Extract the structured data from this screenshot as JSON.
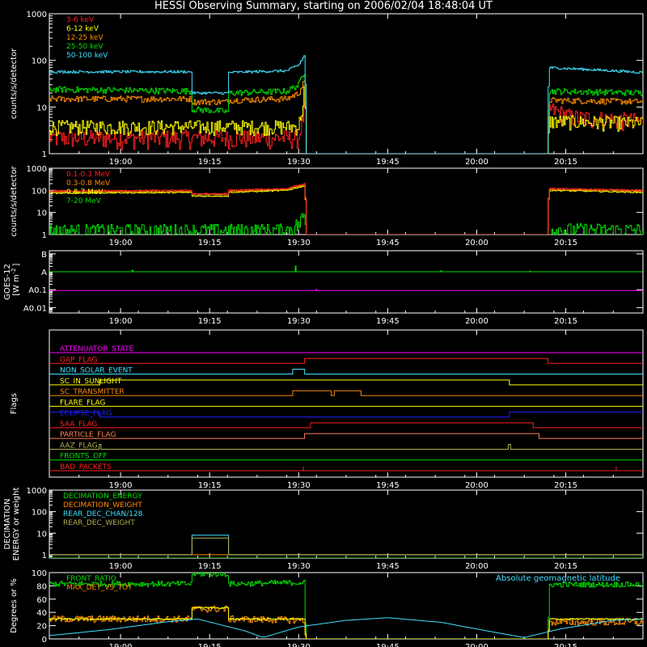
{
  "title": "HESSI Observing Summary, starting on 2006/02/04 18:48:04 UT",
  "time_axis": {
    "ticks": [
      "19:00",
      "19:15",
      "19:30",
      "19:45",
      "20:00",
      "20:15"
    ],
    "tick_minutes": [
      12,
      27,
      42,
      57,
      72,
      87
    ],
    "range_minutes": [
      0,
      100
    ]
  },
  "colors": {
    "red": "#ff2020",
    "orange": "#ff8c00",
    "yellow": "#ffff00",
    "green": "#00e000",
    "cyan": "#40e0ff",
    "magenta": "#ff00ff",
    "blue": "#2020ff",
    "olive": "#b0b050",
    "brown": "#ff7f50",
    "white": "#ffffff"
  },
  "chart_data": [
    {
      "type": "line",
      "name": "count-rates",
      "ylabel": "counts/s/detector",
      "log": true,
      "ylim": [
        1,
        1000
      ],
      "yticks": [
        "1",
        "10",
        "100",
        "1000"
      ],
      "legend": [
        "3-6 keV",
        "6-12 keV",
        "12-25 keV",
        "25-50 keV",
        "50-100 keV"
      ],
      "series": [
        {
          "name": "3-6 keV",
          "color": "red",
          "noise": 0.15,
          "points": [
            [
              0,
              2.2
            ],
            [
              42,
              2.2
            ],
            [
              42.7,
              6
            ],
            [
              43,
              30
            ],
            [
              43.1,
              1
            ],
            [
              84,
              1
            ],
            [
              84.1,
              9
            ],
            [
              88,
              6
            ],
            [
              100,
              5
            ]
          ]
        },
        {
          "name": "6-12 keV",
          "color": "yellow",
          "noise": 0.12,
          "points": [
            [
              0,
              3.8
            ],
            [
              42,
              3.8
            ],
            [
              42.7,
              10
            ],
            [
              43,
              30
            ],
            [
              43.1,
              1
            ],
            [
              84,
              1
            ],
            [
              84.1,
              5
            ],
            [
              100,
              4.5
            ]
          ]
        },
        {
          "name": "12-25 keV",
          "color": "orange",
          "noise": 0.05,
          "points": [
            [
              0,
              15
            ],
            [
              24,
              15
            ],
            [
              24,
              13
            ],
            [
              30,
              13
            ],
            [
              30,
              14
            ],
            [
              40,
              15
            ],
            [
              42,
              20
            ],
            [
              43,
              35
            ],
            [
              43.1,
              1
            ],
            [
              84,
              1
            ],
            [
              84.1,
              14
            ],
            [
              100,
              13
            ]
          ]
        },
        {
          "name": "25-50 keV",
          "color": "green",
          "noise": 0.05,
          "points": [
            [
              0,
              24
            ],
            [
              24,
              22
            ],
            [
              24,
              9
            ],
            [
              30,
              8
            ],
            [
              30,
              20
            ],
            [
              40,
              22
            ],
            [
              42,
              30
            ],
            [
              43,
              60
            ],
            [
              43.1,
              1
            ],
            [
              84,
              1
            ],
            [
              84.1,
              22
            ],
            [
              100,
              20
            ]
          ]
        },
        {
          "name": "50-100 keV",
          "color": "cyan",
          "noise": 0.02,
          "points": [
            [
              0,
              57
            ],
            [
              24,
              57
            ],
            [
              24,
              20
            ],
            [
              30,
              20
            ],
            [
              30,
              55
            ],
            [
              40,
              60
            ],
            [
              42,
              80
            ],
            [
              43,
              130
            ],
            [
              43.1,
              1
            ],
            [
              84,
              1
            ],
            [
              84.1,
              70
            ],
            [
              100,
              55
            ]
          ]
        }
      ]
    },
    {
      "type": "line",
      "name": "high-energy-rates",
      "ylabel": "counts/s/detector",
      "log": true,
      "ylim": [
        1,
        1000
      ],
      "yticks": [
        "1",
        "10",
        "100",
        "1000"
      ],
      "legend": [
        "0.1-0.3 MeV",
        "0.3-0.8 MeV",
        "0.8-7 MeV",
        "7-20 MeV"
      ],
      "series": [
        {
          "name": "7-20 MeV",
          "color": "green",
          "noise": 0.3,
          "points": [
            [
              0,
              1.5
            ],
            [
              40,
              1.6
            ],
            [
              42,
              3
            ],
            [
              43,
              8
            ],
            [
              43.1,
              1
            ],
            [
              84,
              1
            ],
            [
              84.1,
              1.7
            ],
            [
              100,
              1.6
            ]
          ]
        },
        {
          "name": "0.8-7 MeV",
          "color": "yellow",
          "noise": 0.02,
          "points": [
            [
              0,
              75
            ],
            [
              24,
              80
            ],
            [
              24,
              55
            ],
            [
              30,
              55
            ],
            [
              30,
              80
            ],
            [
              40,
              100
            ],
            [
              43,
              160
            ],
            [
              43.1,
              1
            ],
            [
              84,
              1
            ],
            [
              84.1,
              100
            ],
            [
              100,
              80
            ]
          ]
        },
        {
          "name": "0.3-0.8 MeV",
          "color": "orange",
          "noise": 0.02,
          "points": [
            [
              0,
              85
            ],
            [
              24,
              90
            ],
            [
              24,
              65
            ],
            [
              30,
              65
            ],
            [
              30,
              90
            ],
            [
              40,
              110
            ],
            [
              43,
              180
            ],
            [
              43.1,
              1
            ],
            [
              84,
              1
            ],
            [
              84.1,
              110
            ],
            [
              100,
              90
            ]
          ]
        },
        {
          "name": "0.1-0.3 MeV",
          "color": "red",
          "noise": 0.02,
          "points": [
            [
              0,
              95
            ],
            [
              24,
              100
            ],
            [
              24,
              70
            ],
            [
              30,
              70
            ],
            [
              30,
              100
            ],
            [
              40,
              120
            ],
            [
              43,
              200
            ],
            [
              43.1,
              1
            ],
            [
              84,
              1
            ],
            [
              84.1,
              120
            ],
            [
              100,
              100
            ]
          ]
        }
      ]
    },
    {
      "type": "line",
      "name": "goes",
      "ylabel": "GOES-12\n[W m⁻²]",
      "ylabel_lines": [
        "GOES-12",
        "[W m",
        "-2",
        "]"
      ],
      "log": true,
      "ylim": [
        0.005,
        15
      ],
      "yticks": [
        "A0.01",
        "A0.1",
        "A",
        "B"
      ],
      "ytick_values": [
        0.01,
        0.1,
        1,
        10
      ],
      "series": [
        {
          "name": "goes-long",
          "color": "green",
          "noise": 0,
          "points": [
            [
              0,
              1
            ],
            [
              100,
              1
            ]
          ],
          "spikes": [
            [
              14,
              1.3
            ],
            [
              41.5,
              2.2
            ],
            [
              66,
              1.2
            ],
            [
              81,
              1.15
            ]
          ]
        },
        {
          "name": "goes-short",
          "color": "magenta",
          "noise": 0,
          "points": [
            [
              0,
              0.09
            ],
            [
              100,
              0.09
            ]
          ],
          "spikes": [
            [
              45,
              0.11
            ]
          ]
        }
      ]
    },
    {
      "type": "line",
      "name": "flags",
      "ylabel": "Flags",
      "flags": [
        {
          "label": "ATTENUATOR_STATE",
          "color": "magenta",
          "segments": []
        },
        {
          "label": "GAP_FLAG",
          "color": "red",
          "segments": [
            [
              43,
              84
            ]
          ]
        },
        {
          "label": "NON_SOLAR_EVENT",
          "color": "cyan",
          "segments": [
            [
              41,
              43
            ]
          ]
        },
        {
          "label": "SC_IN_SUNLIGHT",
          "color": "yellow",
          "segments": [
            [
              0,
              0
            ]
          ],
          "invert_segments": [
            [
              8.5,
              77.5
            ]
          ]
        },
        {
          "label": "SC_TRANSMITTER",
          "color": "orange",
          "segments": [
            [
              41,
              47.5
            ],
            [
              48,
              52.5
            ]
          ]
        },
        {
          "label": "FLARE_FLAG",
          "color": "yellow",
          "segments": []
        },
        {
          "label": "ECLIPSE_FLAG",
          "color": "blue",
          "segments": [
            [
              0,
              8.5
            ],
            [
              77.5,
              100
            ]
          ]
        },
        {
          "label": "SAA_FLAG",
          "color": "red",
          "segments": [
            [
              44,
              81.5
            ]
          ]
        },
        {
          "label": "PARTICLE_FLAG",
          "color": "brown",
          "segments": [
            [
              43,
              82.5
            ]
          ]
        },
        {
          "label": "AAZ_FLAG",
          "color": "olive",
          "segments": [
            [
              8.4,
              8.7
            ],
            [
              77.3,
              77.7
            ]
          ]
        },
        {
          "label": "FRONTS_OFF",
          "color": "green",
          "segments": []
        },
        {
          "label": "BAD_PACKETS",
          "color": "red",
          "segments": [],
          "ticks": [
            42.8,
            95.5
          ]
        }
      ]
    },
    {
      "type": "line",
      "name": "decimation",
      "ylabel": "DECIMATION\nENERGY or weight",
      "ylabel_lines": [
        "DECIMATION",
        "ENERGY or weight"
      ],
      "log": true,
      "ylim": [
        0.7,
        1000
      ],
      "yticks": [
        "1",
        "10",
        "100",
        "1000"
      ],
      "legend": [
        "DECIMATION_ENERGY",
        "DECIMATION_WEIGHT",
        "REAR_DEC_CHAN/128",
        "REAR_DEC_WEIGHT"
      ],
      "series": [
        {
          "name": "DECIMATION_ENERGY",
          "color": "green",
          "noise": 0,
          "points": [
            [
              0,
              0.7
            ],
            [
              100,
              0.7
            ]
          ]
        },
        {
          "name": "DECIMATION_WEIGHT",
          "color": "orange",
          "noise": 0,
          "points": [
            [
              0,
              1
            ],
            [
              100,
              1
            ]
          ]
        },
        {
          "name": "REAR_DEC_CHAN/128",
          "color": "cyan",
          "noise": 0,
          "points": [
            [
              0,
              1
            ],
            [
              24,
              1
            ],
            [
              24,
              8
            ],
            [
              30,
              8
            ],
            [
              30,
              1
            ],
            [
              100,
              1
            ]
          ]
        },
        {
          "name": "REAR_DEC_WEIGHT",
          "color": "olive",
          "noise": 0,
          "points": [
            [
              0,
              1
            ],
            [
              24,
              1
            ],
            [
              24,
              6
            ],
            [
              30,
              6
            ],
            [
              30,
              1
            ],
            [
              100,
              1
            ]
          ]
        }
      ]
    },
    {
      "type": "line",
      "name": "ratios",
      "ylabel": "Degrees or %",
      "log": false,
      "ylim": [
        0,
        100
      ],
      "yticks": [
        "0",
        "20",
        "40",
        "60",
        "80",
        "100"
      ],
      "ytick_values": [
        0,
        20,
        40,
        60,
        80,
        100
      ],
      "legend": [
        "FRONT_RATIO",
        "MAX_DET_VS_TOT"
      ],
      "legend_right": "Absolute geomagnetic latitude",
      "series": [
        {
          "name": "FRONT_RATIO",
          "color": "green",
          "noise": 4,
          "points": [
            [
              0,
              83
            ],
            [
              24,
              83
            ],
            [
              24,
              98
            ],
            [
              30,
              98
            ],
            [
              30,
              83
            ],
            [
              43,
              85
            ],
            [
              43.1,
              0
            ],
            [
              84,
              0
            ],
            [
              84.1,
              82
            ],
            [
              100,
              82
            ]
          ]
        },
        {
          "name": "MAX_DET_VS_TOT",
          "color": "orange",
          "noise": 5,
          "points": [
            [
              0,
              30
            ],
            [
              24,
              30
            ],
            [
              24,
              45
            ],
            [
              30,
              45
            ],
            [
              30,
              30
            ],
            [
              43,
              28
            ],
            [
              43.1,
              0
            ],
            [
              84,
              0
            ],
            [
              84.1,
              25
            ],
            [
              100,
              25
            ]
          ]
        },
        {
          "name": "mid-yellow",
          "color": "yellow",
          "noise": 1,
          "points": [
            [
              0,
              30
            ],
            [
              24,
              30
            ],
            [
              24,
              47
            ],
            [
              30,
              47
            ],
            [
              30,
              30
            ],
            [
              43,
              30
            ],
            [
              43.1,
              0
            ],
            [
              84,
              0
            ],
            [
              84.1,
              30
            ],
            [
              100,
              30
            ]
          ]
        },
        {
          "name": "Absolute geomagnetic latitude",
          "color": "cyan",
          "noise": 0,
          "smooth": true,
          "points": [
            [
              0,
              5
            ],
            [
              10,
              14
            ],
            [
              20,
              26
            ],
            [
              25,
              30
            ],
            [
              33,
              12
            ],
            [
              36,
              2
            ],
            [
              42,
              18
            ],
            [
              50,
              28
            ],
            [
              57,
              32
            ],
            [
              66,
              25
            ],
            [
              75,
              10
            ],
            [
              80,
              2
            ],
            [
              86,
              15
            ],
            [
              95,
              28
            ],
            [
              100,
              30
            ]
          ]
        }
      ]
    }
  ]
}
